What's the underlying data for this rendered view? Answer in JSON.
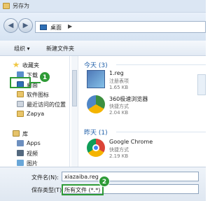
{
  "window": {
    "title": "另存为"
  },
  "address": {
    "location": "桌面",
    "arrow": "▶"
  },
  "toolbar": {
    "organize": "组织 ▾",
    "new_folder": "新建文件夹"
  },
  "sidebar": {
    "favorites": "收藏夹",
    "downloads": "下载",
    "desktop": "桌面",
    "software_icons": "软件图标",
    "recent": "最近访问的位置",
    "zapya": "Zapya",
    "library": "库",
    "apps": "Apps",
    "videos": "视频",
    "pictures": "图片"
  },
  "content": {
    "group_today": "今天 (3)",
    "group_yesterday": "昨天 (1)",
    "files": [
      {
        "name": "1.reg",
        "type": "注册表项",
        "size": "1.65 KB"
      },
      {
        "name": "360极速浏览器",
        "type": "快捷方式",
        "size": "2.04 KB"
      },
      {
        "name": "Google Chrome",
        "type": "快捷方式",
        "size": "2.19 KB"
      }
    ]
  },
  "save": {
    "filename_label": "文件名(N):",
    "filename_value": "xiazaiba.reg",
    "type_label": "保存类型(T):",
    "type_value": "所有文件 (*.*)"
  },
  "annotations": {
    "step1": "1",
    "step2": "2"
  },
  "colors": {
    "annotation_green": "#2f9b37",
    "link_blue": "#1e5ea8"
  }
}
